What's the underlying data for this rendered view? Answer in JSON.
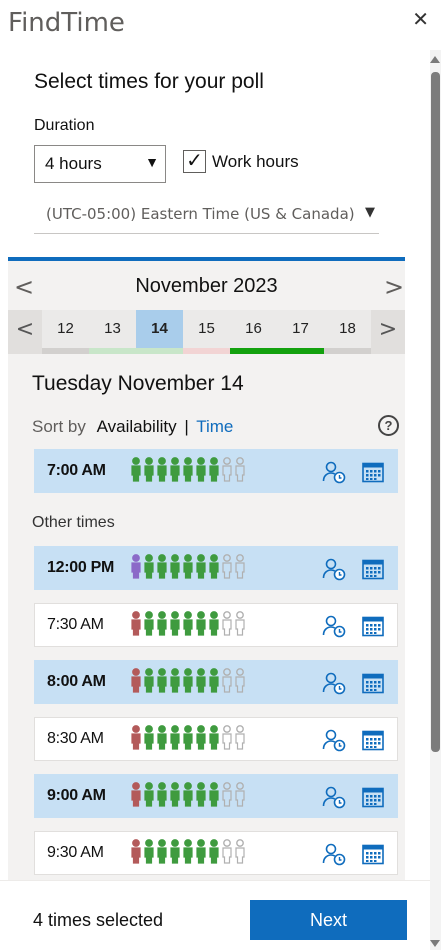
{
  "app": {
    "title": "FindTime",
    "close_glyph": "✕"
  },
  "form": {
    "heading": "Select times for your poll",
    "duration_label": "Duration",
    "duration_value": "4 hours",
    "work_hours_checked": true,
    "work_hours_label": "Work hours",
    "timezone_value": "(UTC-05:00) Eastern Time (US & Canada)"
  },
  "calendar": {
    "month_title": "November 2023",
    "prev_glyph": "<",
    "next_glyph": ">",
    "days": [
      {
        "label": "12",
        "bar_color": "#d2d0ce",
        "selected": false
      },
      {
        "label": "13",
        "bar_color": "#c8e6c9",
        "selected": false
      },
      {
        "label": "14",
        "bar_color": "#c8e6c9",
        "selected": true
      },
      {
        "label": "15",
        "bar_color": "#f2d4d4",
        "selected": false
      },
      {
        "label": "16",
        "bar_color": "#13a10e",
        "selected": false
      },
      {
        "label": "17",
        "bar_color": "#13a10e",
        "selected": false
      },
      {
        "label": "18",
        "bar_color": "#d2d0ce",
        "selected": false
      }
    ]
  },
  "day_view": {
    "date_heading": "Tuesday November 14",
    "sort_by_label": "Sort by",
    "sort_availability": "Availability",
    "sort_separator": "|",
    "sort_time": "Time",
    "help_glyph": "?",
    "other_times_label": "Other times"
  },
  "colors": {
    "accent": "#0f6cbd",
    "selected_slot": "#c7e0f4",
    "attendee_free": "#3f9b3f",
    "attendee_busy": "#b35a5a",
    "attendee_organizer": "#8b6ac8",
    "attendee_unknown": "#b0b0b0"
  },
  "slots": [
    {
      "time": "7:00 AM",
      "selected": true,
      "attendees": [
        "free",
        "free",
        "free",
        "free",
        "free",
        "free",
        "free",
        "unknown",
        "unknown"
      ]
    },
    {
      "time": "12:00 PM",
      "selected": true,
      "attendees": [
        "organizer",
        "free",
        "free",
        "free",
        "free",
        "free",
        "free",
        "unknown",
        "unknown"
      ]
    },
    {
      "time": "7:30 AM",
      "selected": false,
      "attendees": [
        "busy",
        "free",
        "free",
        "free",
        "free",
        "free",
        "free",
        "unknown",
        "unknown"
      ]
    },
    {
      "time": "8:00 AM",
      "selected": true,
      "attendees": [
        "busy",
        "free",
        "free",
        "free",
        "free",
        "free",
        "free",
        "unknown",
        "unknown"
      ]
    },
    {
      "time": "8:30 AM",
      "selected": false,
      "attendees": [
        "busy",
        "free",
        "free",
        "free",
        "free",
        "free",
        "free",
        "unknown",
        "unknown"
      ]
    },
    {
      "time": "9:00 AM",
      "selected": true,
      "attendees": [
        "busy",
        "free",
        "free",
        "free",
        "free",
        "free",
        "free",
        "unknown",
        "unknown"
      ]
    },
    {
      "time": "9:30 AM",
      "selected": false,
      "attendees": [
        "busy",
        "free",
        "free",
        "free",
        "free",
        "free",
        "free",
        "unknown",
        "unknown"
      ]
    }
  ],
  "footer": {
    "selected_count_text": "4 times selected",
    "next_label": "Next"
  }
}
